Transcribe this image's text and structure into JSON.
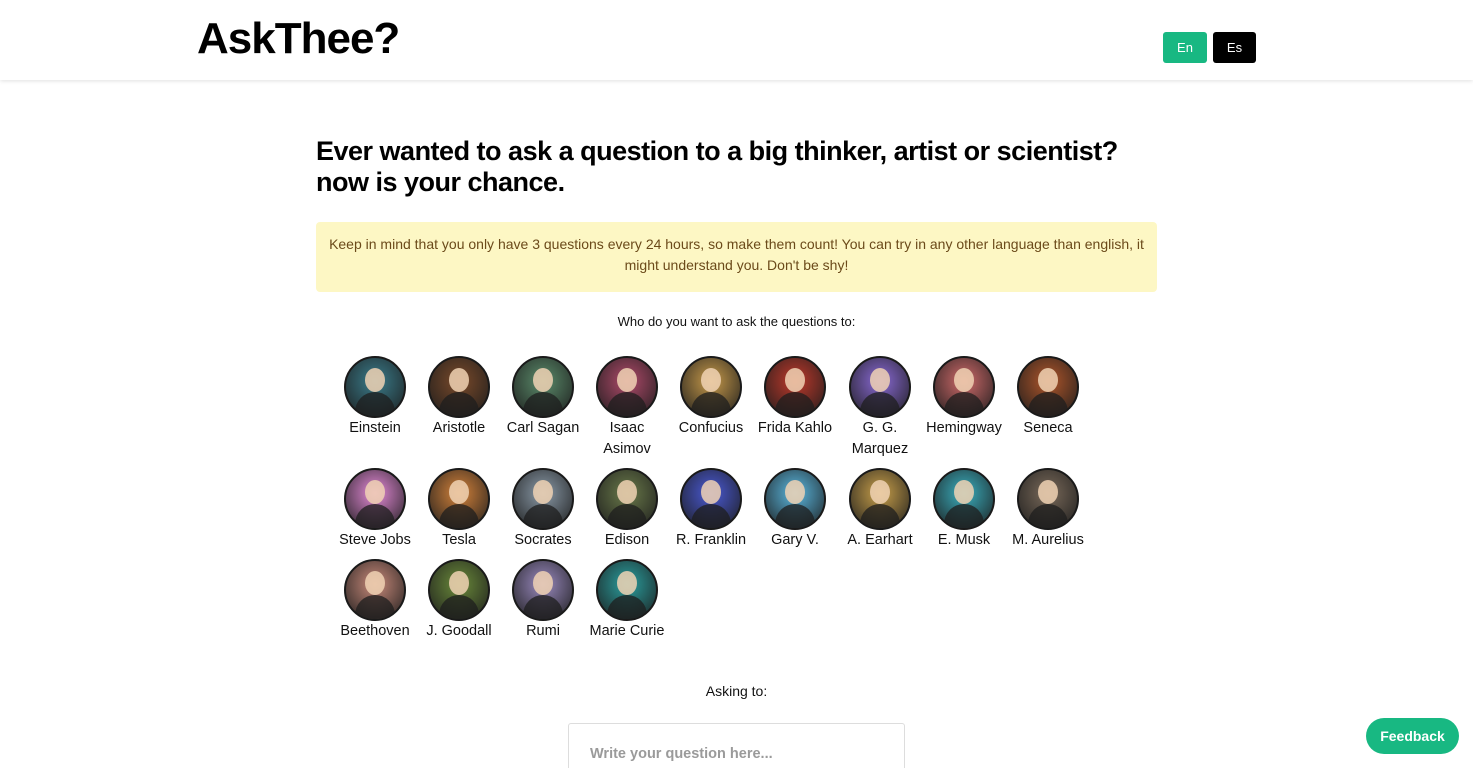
{
  "header": {
    "logo": "AskThee?",
    "lang_en": "En",
    "lang_es": "Es"
  },
  "main": {
    "headline": "Ever wanted to ask a question to a big thinker, artist or scientist? now is your chance.",
    "notice": "Keep in mind that you only have 3 questions every 24 hours, so make them count!  You can try in any other language than english, it might understand you. Don't be shy!",
    "who_label": "Who do you want to ask the questions to:",
    "asking_label": "Asking to:",
    "question_placeholder": "Write your question here..."
  },
  "people": [
    {
      "name": "Einstein",
      "color": "#3a7d8c"
    },
    {
      "name": "Aristotle",
      "color": "#7a4a2a"
    },
    {
      "name": "Carl Sagan",
      "color": "#5b8c6b"
    },
    {
      "name": "Isaac Asimov",
      "color": "#b04a6a"
    },
    {
      "name": "Confucius",
      "color": "#c79a4a"
    },
    {
      "name": "Frida Kahlo",
      "color": "#c0392b"
    },
    {
      "name": "G. G. Marquez",
      "color": "#8a6ad6"
    },
    {
      "name": "Hemingway",
      "color": "#d06a6a"
    },
    {
      "name": "Seneca",
      "color": "#b0562a"
    },
    {
      "name": "Steve Jobs",
      "color": "#e58ad8"
    },
    {
      "name": "Tesla",
      "color": "#d4823a"
    },
    {
      "name": "Socrates",
      "color": "#8a9aa8"
    },
    {
      "name": "Edison",
      "color": "#6a7a4a"
    },
    {
      "name": "R. Franklin",
      "color": "#4a5ad6"
    },
    {
      "name": "Gary V.",
      "color": "#5ab8e0"
    },
    {
      "name": "A. Earhart",
      "color": "#c9a04a"
    },
    {
      "name": "E. Musk",
      "color": "#3ab0c0"
    },
    {
      "name": "M. Aurelius",
      "color": "#7a6a5a"
    },
    {
      "name": "Beethoven",
      "color": "#c98a7a"
    },
    {
      "name": "J. Goodall",
      "color": "#6a8a3a"
    },
    {
      "name": "Rumi",
      "color": "#9a8ac0"
    },
    {
      "name": "Marie Curie",
      "color": "#2aa0a0"
    }
  ],
  "feedback_label": "Feedback"
}
